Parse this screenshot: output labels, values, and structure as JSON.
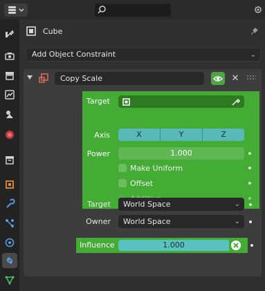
{
  "header": {
    "search_placeholder": ""
  },
  "object": {
    "name": "Cube"
  },
  "add_constraint": {
    "label": "Add Object Constraint"
  },
  "constraint": {
    "name": "Copy Scale",
    "target_label": "Target",
    "axis_label": "Axis",
    "axes": [
      "X",
      "Y",
      "Z"
    ],
    "power_label": "Power",
    "power_value": "1.000",
    "make_uniform": "Make Uniform",
    "offset": "Offset",
    "additive": "Additive",
    "space_target_label": "Target",
    "space_target_value": "World Space",
    "space_owner_label": "Owner",
    "space_owner_value": "World Space",
    "influence_label": "Influence",
    "influence_value": "1.000"
  },
  "colors": {
    "accent_green": "#44ac34",
    "axis_teal": "#59b9b9"
  },
  "tabs": [
    "tool-icon",
    "render-icon",
    "output-icon",
    "view-layer-icon",
    "scene-icon",
    "world-icon",
    "collection-icon",
    "object-icon",
    "modifier-icon",
    "particles-icon",
    "physics-icon",
    "constraints-icon",
    "data-icon"
  ]
}
